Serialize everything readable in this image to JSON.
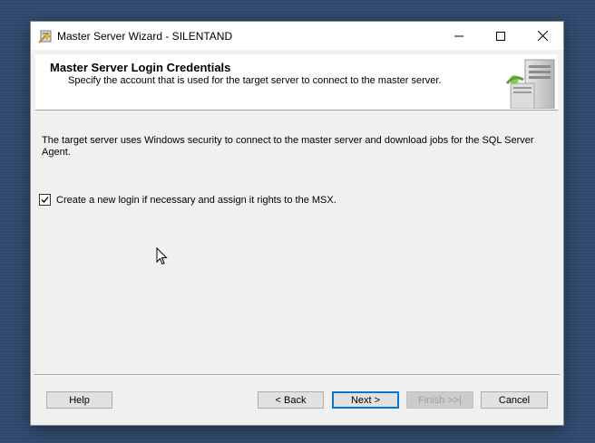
{
  "window": {
    "title": "Master Server Wizard - SILENTAND"
  },
  "header": {
    "title": "Master Server Login Credentials",
    "subtitle": "Specify the account that is used for the target server to connect to the master server."
  },
  "content": {
    "description": "The target server uses Windows security to connect to the master server and download jobs for the SQL Server Agent.",
    "checkbox": {
      "label": "Create a new login if necessary and assign it rights to the MSX.",
      "checked": true
    }
  },
  "buttons": {
    "help": "Help",
    "back": "< Back",
    "next": "Next >",
    "finish": "Finish >>|",
    "cancel": "Cancel"
  },
  "colors": {
    "desktop": "#2f4a6e",
    "dialog": "#f0f0f0",
    "focus_accent": "#0078d7"
  },
  "icons": [
    "wizard-app-icon",
    "minimize-icon",
    "maximize-icon",
    "close-icon",
    "server-graphic-icon",
    "checkmark-icon",
    "mouse-cursor-icon"
  ]
}
